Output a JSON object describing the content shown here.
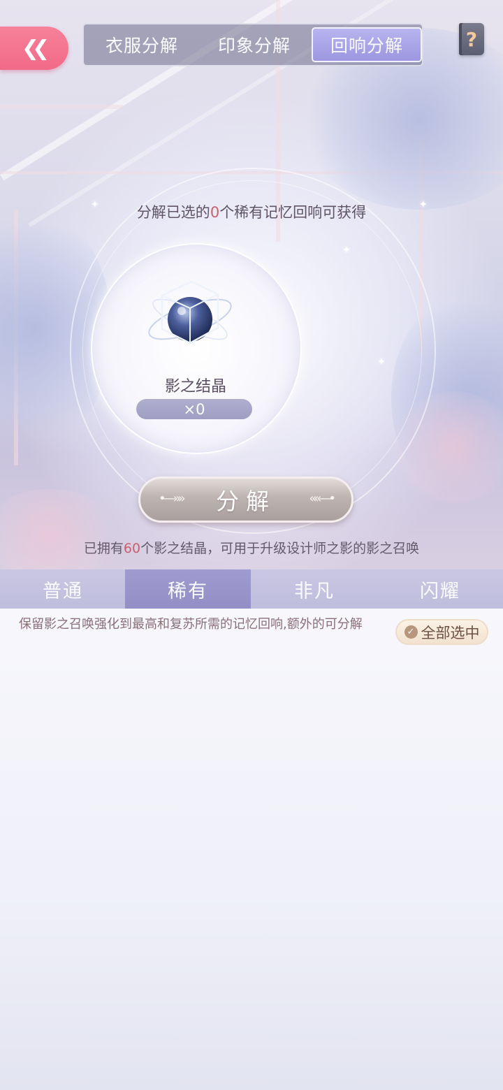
{
  "header": {
    "tabs": [
      {
        "label": "衣服分解",
        "active": false
      },
      {
        "label": "印象分解",
        "active": false
      },
      {
        "label": "回响分解",
        "active": true
      }
    ],
    "help_label": "?"
  },
  "gain_info": {
    "prefix": "分解已选的",
    "selected_count": "0",
    "suffix": "个稀有记忆回响可获得"
  },
  "reward": {
    "name": "影之结晶",
    "count": "×0",
    "icon": "shadow-crystal-icon"
  },
  "decompose_button": {
    "label": "分解"
  },
  "owned_info": {
    "prefix": "已拥有",
    "owned_count": "60",
    "suffix": "个影之结晶，可用于升级设计师之影的影之召唤"
  },
  "rarity_tabs": [
    {
      "label": "普通",
      "active": false
    },
    {
      "label": "稀有",
      "active": true
    },
    {
      "label": "非凡",
      "active": false
    },
    {
      "label": "闪耀",
      "active": false
    }
  ],
  "content": {
    "note": "保留影之召唤强化到最高和复苏所需的记忆回响,额外的可分解",
    "select_all_label": "全部选中"
  },
  "colors": {
    "back_button": "#f26a87",
    "active_tab": "#9c97e0",
    "highlight_number": "#c8606c",
    "rarity_active": "#938fc6"
  }
}
